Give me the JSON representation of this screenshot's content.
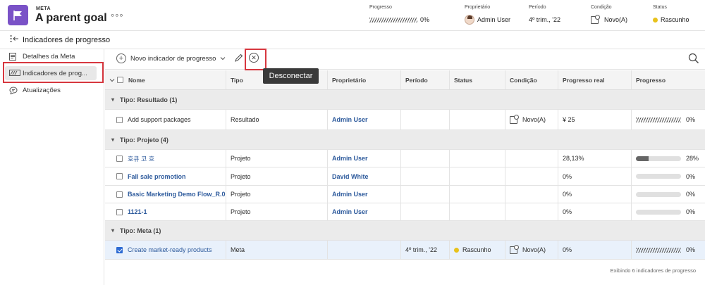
{
  "header": {
    "type_label": "META",
    "title": "A parent goal",
    "more_glyph": "°°°",
    "progress": {
      "label": "Progresso",
      "value": "0%",
      "fraction": 0
    },
    "owner": {
      "label": "Proprietário",
      "value": "Admin User"
    },
    "period": {
      "label": "Período",
      "value": "4º trim., '22"
    },
    "condition": {
      "label": "Condição",
      "value": "Novo(A)"
    },
    "status": {
      "label": "Status",
      "value": "Rascunho",
      "color": "#e8c21c"
    }
  },
  "back_row": {
    "title": "Indicadores de progresso"
  },
  "sidebar": {
    "items": [
      {
        "label": "Detalhes da Meta",
        "icon": "document-icon"
      },
      {
        "label": "Indicadores de prog...",
        "icon": "progress-indicator-icon",
        "active": true
      },
      {
        "label": "Atualizações",
        "icon": "chat-bubble-icon"
      }
    ]
  },
  "toolbar": {
    "new_label": "Novo indicador de progresso",
    "tooltip": "Desconectar"
  },
  "table": {
    "columns": [
      "Nome",
      "Tipo",
      "Proprietário",
      "Período",
      "Status",
      "Condição",
      "Progresso real",
      "Progresso"
    ],
    "groups": [
      {
        "label": "Tipo: Resultado (1)"
      },
      {
        "label": "Tipo: Projeto (4)"
      },
      {
        "label": "Tipo: Meta (1)"
      }
    ],
    "rows": [
      {
        "name": "Add support packages",
        "type": "Resultado",
        "owner": "Admin User",
        "period": "",
        "status": "",
        "condition": "Novo(A)",
        "real": "¥ 25",
        "progress": "0%"
      },
      {
        "name": "호큐 코 흐",
        "type": "Projeto",
        "owner": "Admin User",
        "period": "",
        "status": "",
        "condition": "",
        "real": "28,13%",
        "progress": "28%",
        "fraction": 0.28
      },
      {
        "name": "Fall sale promotion",
        "type": "Projeto",
        "owner": "David White",
        "period": "",
        "status": "",
        "condition": "",
        "real": "0%",
        "progress": "0%",
        "fraction": 0
      },
      {
        "name": "Basic Marketing Demo Flow_R.0",
        "type": "Projeto",
        "owner": "Admin User",
        "period": "",
        "status": "",
        "condition": "",
        "real": "0%",
        "progress": "0%",
        "fraction": 0
      },
      {
        "name": "1121-1",
        "type": "Projeto",
        "owner": "Admin User",
        "period": "",
        "status": "",
        "condition": "",
        "real": "0%",
        "progress": "0%",
        "fraction": 0
      },
      {
        "name": "Create market-ready products",
        "type": "Meta",
        "owner": "",
        "period": "4º trim., '22",
        "status": "Rascunho",
        "condition": "Novo(A)",
        "real": "0%",
        "progress": "0%"
      }
    ]
  },
  "footer": {
    "text": "Exibindo 6 indicadores de progresso"
  }
}
